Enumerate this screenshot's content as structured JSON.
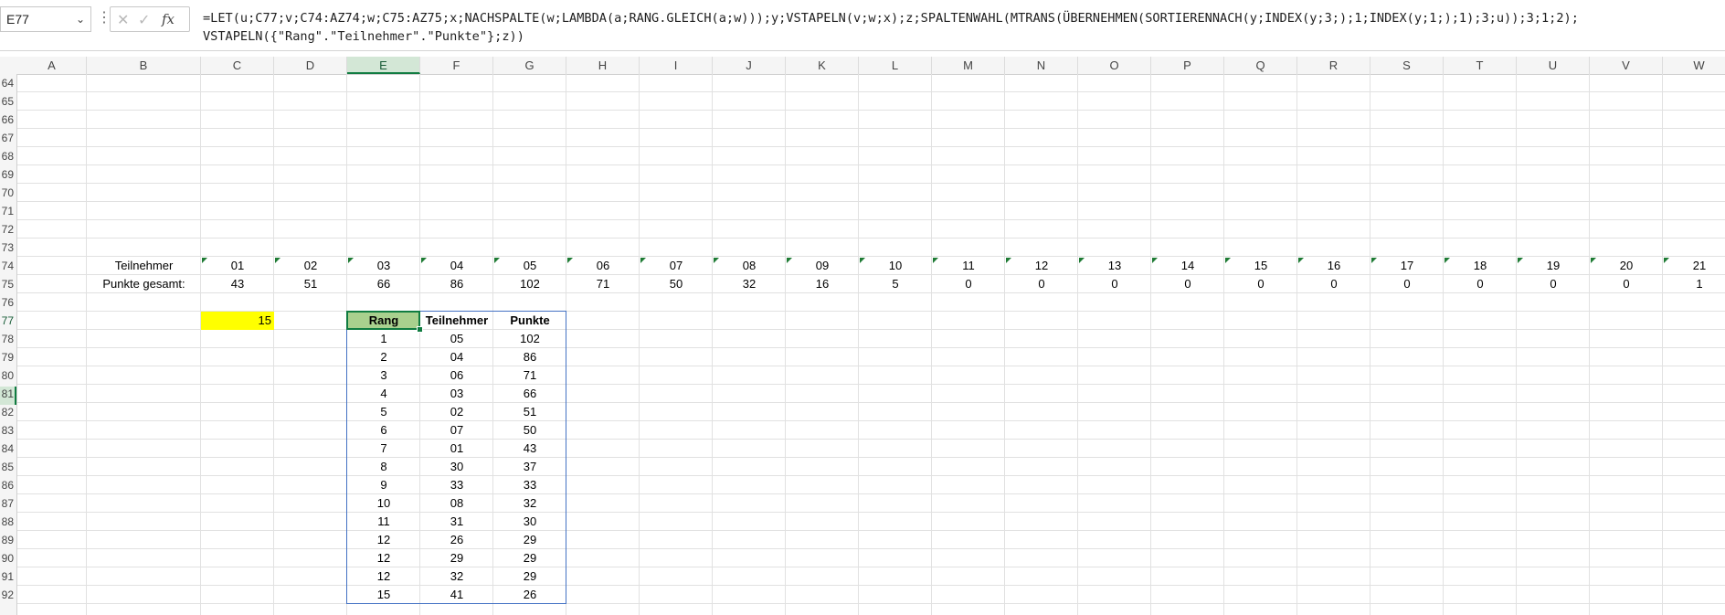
{
  "formula_bar": {
    "name_box": "E77",
    "cancel_glyph": "✕",
    "enter_glyph": "✓",
    "fx_label": "fx",
    "formula_line1": "=LET(u;C77;v;C74:AZ74;w;C75:AZ75;x;NACHSPALTE(w;LAMBDA(a;RANG.GLEICH(a;w)));y;VSTAPELN(v;w;x);z;SPALTENWAHL(MTRANS(ÜBERNEHMEN(SORTIERENNACH(y;INDEX(y;3;);1;INDEX(y;1;);1);3;u));3;1;2);",
    "formula_line2": "VSTAPELN({\"Rang\".\"Teilnehmer\".\"Punkte\"};z))"
  },
  "columns": [
    "A",
    "B",
    "C",
    "D",
    "E",
    "F",
    "G",
    "H",
    "I",
    "J",
    "K",
    "L",
    "M",
    "N",
    "O",
    "P",
    "Q",
    "R",
    "S",
    "T",
    "U",
    "V",
    "W"
  ],
  "selected_column": "E",
  "rows": [
    "64",
    "65",
    "66",
    "67",
    "68",
    "69",
    "70",
    "71",
    "72",
    "73",
    "74",
    "75",
    "76",
    "77",
    "78",
    "79",
    "80",
    "81",
    "82",
    "83",
    "84",
    "85",
    "86",
    "87",
    "88",
    "89",
    "90",
    "91",
    "92"
  ],
  "selected_row": "77",
  "sheet": {
    "teilnehmer_label": "Teilnehmer",
    "punkte_label": "Punkte gesamt:",
    "participants": [
      "01",
      "02",
      "03",
      "04",
      "05",
      "06",
      "07",
      "08",
      "09",
      "10",
      "11",
      "12",
      "13",
      "14",
      "15",
      "16",
      "17",
      "18",
      "19",
      "20",
      "21"
    ],
    "points": [
      "43",
      "51",
      "66",
      "86",
      "102",
      "71",
      "50",
      "32",
      "16",
      "5",
      "0",
      "0",
      "0",
      "0",
      "0",
      "0",
      "0",
      "0",
      "0",
      "0",
      "1"
    ],
    "c77_value": "15"
  },
  "result_table": {
    "headers": [
      "Rang",
      "Teilnehmer",
      "Punkte"
    ],
    "rows": [
      [
        "1",
        "05",
        "102"
      ],
      [
        "2",
        "04",
        "86"
      ],
      [
        "3",
        "06",
        "71"
      ],
      [
        "4",
        "03",
        "66"
      ],
      [
        "5",
        "02",
        "51"
      ],
      [
        "6",
        "07",
        "50"
      ],
      [
        "7",
        "01",
        "43"
      ],
      [
        "8",
        "30",
        "37"
      ],
      [
        "9",
        "33",
        "33"
      ],
      [
        "10",
        "08",
        "32"
      ],
      [
        "11",
        "31",
        "30"
      ],
      [
        "12",
        "26",
        "29"
      ],
      [
        "12",
        "29",
        "29"
      ],
      [
        "12",
        "32",
        "29"
      ],
      [
        "15",
        "41",
        "26"
      ]
    ]
  },
  "colors": {
    "accent": "#107c41",
    "highlight": "#ffff00",
    "header_fill": "#a9d08e",
    "table_border": "#4472c4"
  }
}
